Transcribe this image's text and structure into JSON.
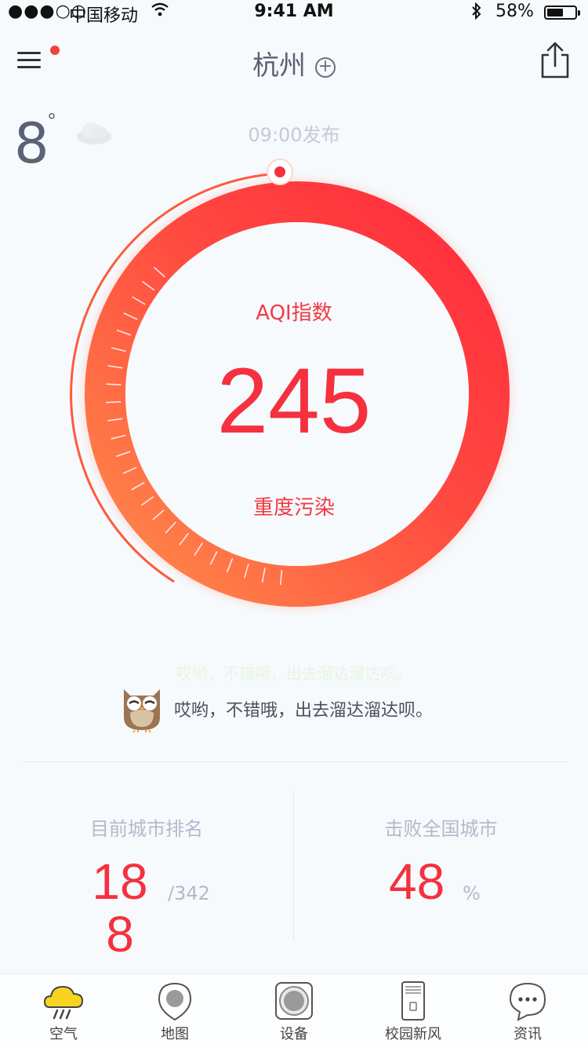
{
  "status_bar": {
    "signal": "●●●○○",
    "carrier": "中国移动",
    "time": "9:41 AM",
    "battery_text": "58%",
    "battery_level": 0.58
  },
  "header": {
    "city": "杭州",
    "add_symbol": "+",
    "menu_badge": true,
    "icons": [
      "menu-icon",
      "add-city-icon",
      "share-icon"
    ]
  },
  "weather": {
    "temperature": "8",
    "degree_symbol": "°",
    "icon": "cloud-icon",
    "publish_time": "09:00发布"
  },
  "aqi": {
    "label": "AQI指数",
    "value": "245",
    "level": "重度污染",
    "colors": {
      "start": "#ff8c4a",
      "end": "#ff2a3c"
    }
  },
  "tip": {
    "text": "哎哟，不错哦，出去溜达溜达呗。",
    "icon": "owl-icon"
  },
  "stats": {
    "rank_title": "目前城市排名",
    "rank_value": "188",
    "rank_total": "/342",
    "beat_title": "击败全国城市",
    "beat_value": "48",
    "beat_unit": "%"
  },
  "tabs": [
    {
      "label": "空气",
      "icon": "weather-icon"
    },
    {
      "label": "地图",
      "icon": "map-pin-icon"
    },
    {
      "label": "设备",
      "icon": "device-icon"
    },
    {
      "label": "校园新风",
      "icon": "air-purifier-icon"
    },
    {
      "label": "资讯",
      "icon": "chat-bubble-icon"
    }
  ]
}
